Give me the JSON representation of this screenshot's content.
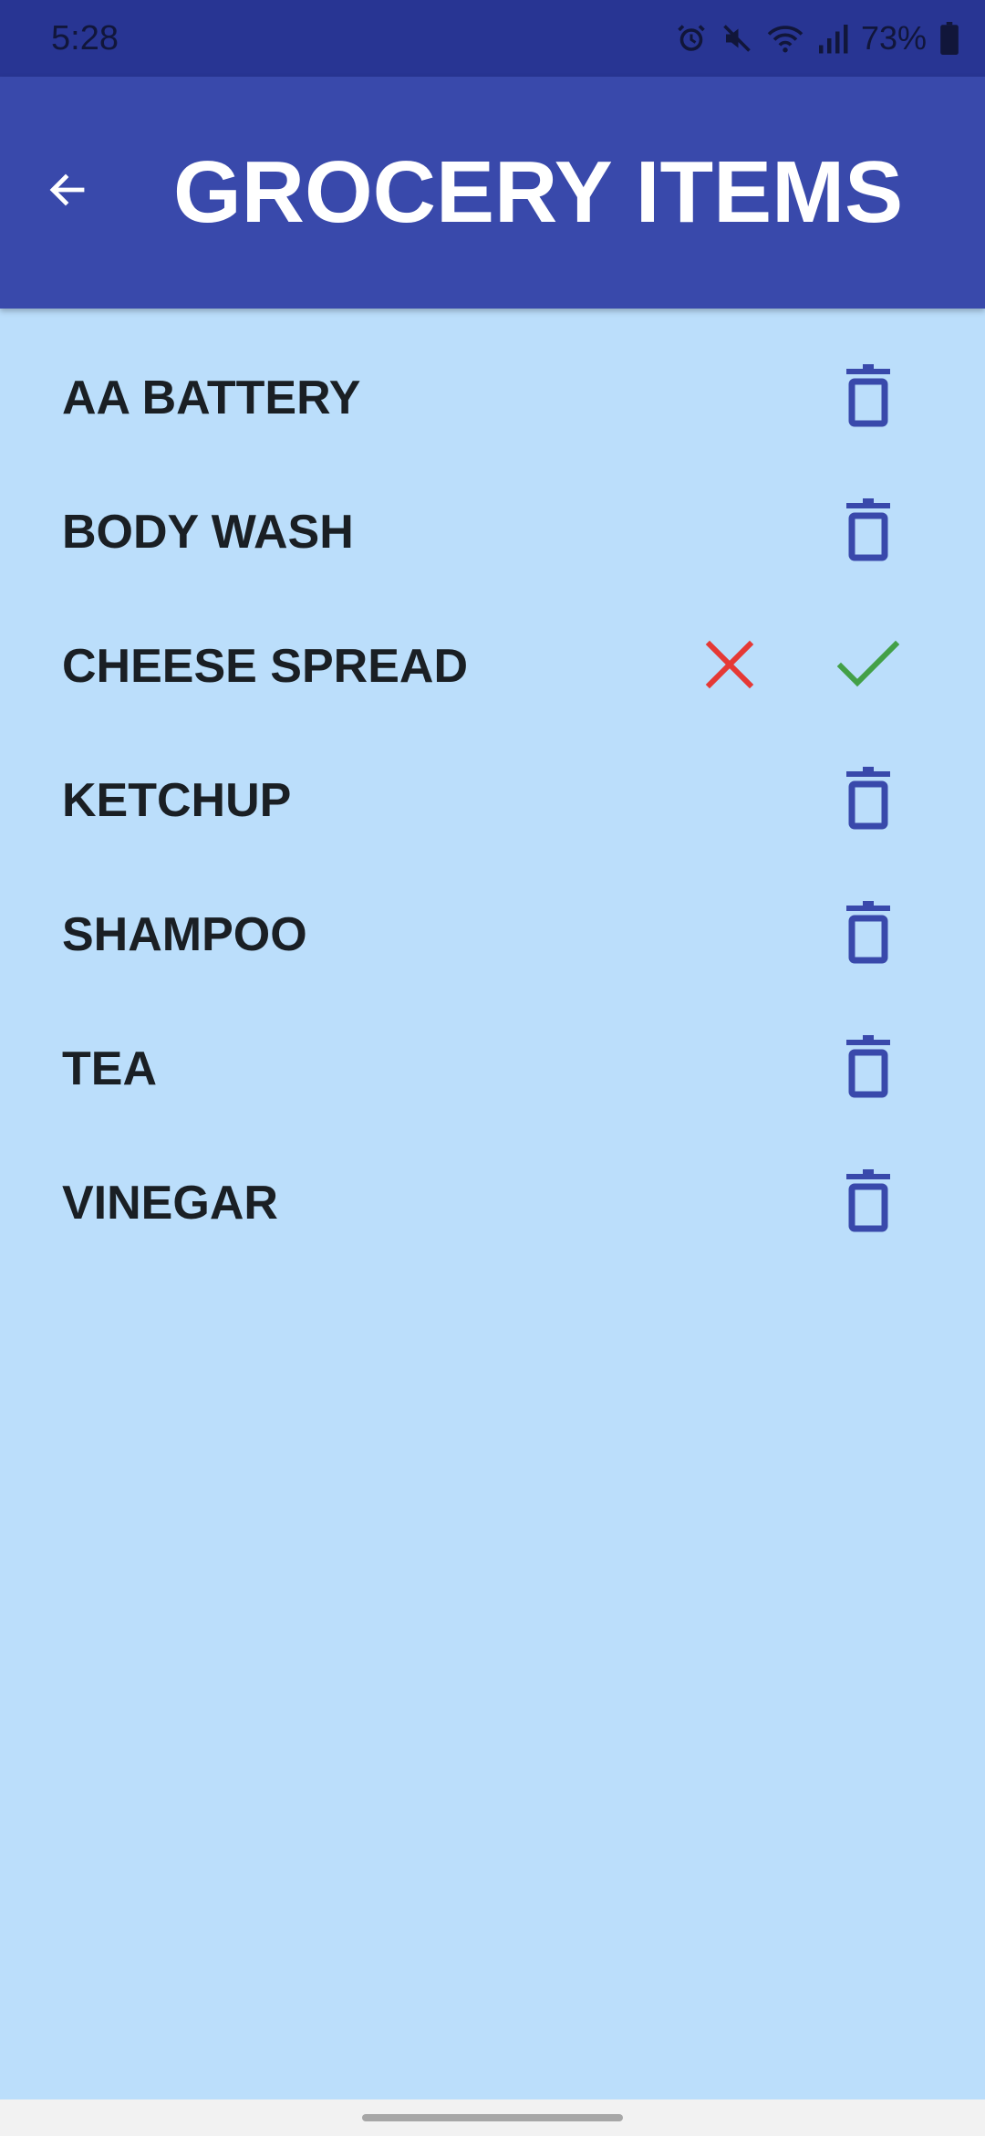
{
  "status_bar": {
    "time": "5:28",
    "battery": "73%",
    "icons": [
      "alarm-icon",
      "mute-icon",
      "wifi-icon",
      "signal-icon",
      "battery-icon"
    ]
  },
  "app_bar": {
    "title": "GROCERY ITEMS",
    "back_icon": "arrow-back-icon"
  },
  "items": [
    {
      "label": "AA BATTERY",
      "actions": [
        "delete"
      ]
    },
    {
      "label": "BODY WASH",
      "actions": [
        "delete"
      ]
    },
    {
      "label": "CHEESE SPREAD",
      "actions": [
        "cancel",
        "confirm"
      ]
    },
    {
      "label": "KETCHUP",
      "actions": [
        "delete"
      ]
    },
    {
      "label": "SHAMPOO",
      "actions": [
        "delete"
      ]
    },
    {
      "label": "TEA",
      "actions": [
        "delete"
      ]
    },
    {
      "label": "VINEGAR",
      "actions": [
        "delete"
      ]
    }
  ],
  "colors": {
    "status_bar": "#283593",
    "app_bar": "#3949ab",
    "background": "#bbdefb",
    "delete_icon": "#3949ab",
    "cancel_icon": "#e53935",
    "confirm_icon": "#43a047"
  }
}
